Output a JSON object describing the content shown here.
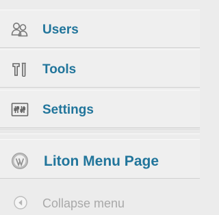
{
  "menu": {
    "items": [
      {
        "label": "Users",
        "icon": "users-icon"
      },
      {
        "label": "Tools",
        "icon": "tools-icon"
      },
      {
        "label": "Settings",
        "icon": "settings-icon"
      }
    ],
    "plugin_item": {
      "label": "Liton Menu Page",
      "icon": "wordpress-icon"
    },
    "collapse": {
      "label": "Collapse menu",
      "icon": "collapse-arrow-icon"
    }
  },
  "colors": {
    "link": "#21759b",
    "muted": "#a9a9a9",
    "background": "#ececec"
  }
}
